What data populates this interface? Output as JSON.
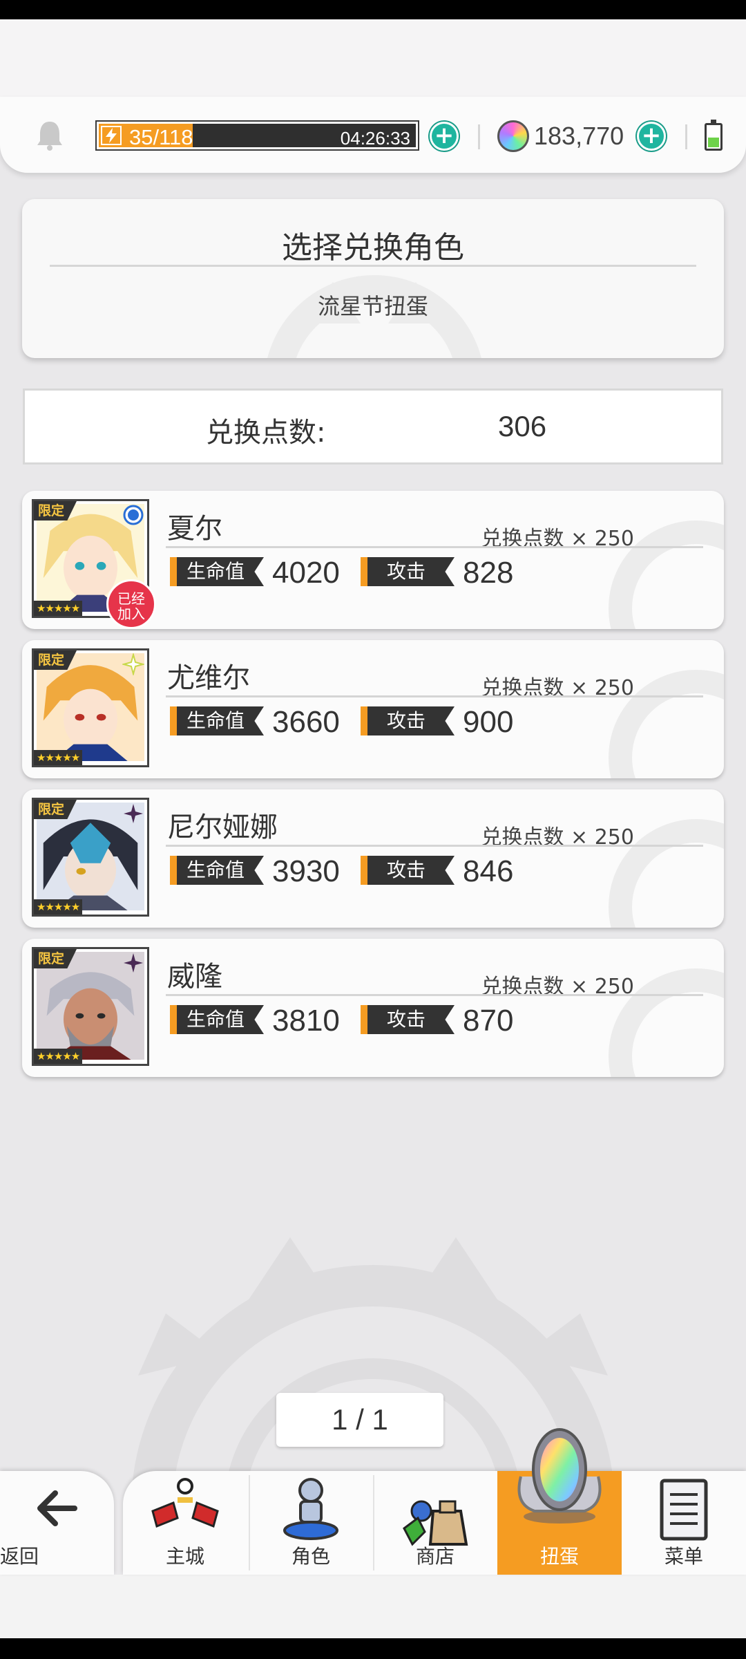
{
  "resource_bar": {
    "stamina_text": "35/118",
    "stamina_fraction": 0.297,
    "stamina_timer": "04:26:33",
    "gems": "183,770"
  },
  "header": {
    "title": "选择兑换角色",
    "subtitle": "流星节扭蛋"
  },
  "points": {
    "label": "兑换点数:",
    "value": "306"
  },
  "characters": [
    {
      "name": "夏尔",
      "cost": "兑换点数 × 250",
      "hp_label": "生命值",
      "hp": "4020",
      "atk_label": "攻击",
      "atk": "828",
      "tag": "限定",
      "joined": "已经加入",
      "stars": "★★★★★"
    },
    {
      "name": "尤维尔",
      "cost": "兑换点数 × 250",
      "hp_label": "生命值",
      "hp": "3660",
      "atk_label": "攻击",
      "atk": "900",
      "tag": "限定",
      "stars": "★★★★★"
    },
    {
      "name": "尼尔娅娜",
      "cost": "兑换点数 × 250",
      "hp_label": "生命值",
      "hp": "3930",
      "atk_label": "攻击",
      "atk": "846",
      "tag": "限定",
      "stars": "★★★★★"
    },
    {
      "name": "威隆",
      "cost": "兑换点数 × 250",
      "hp_label": "生命值",
      "hp": "3810",
      "atk_label": "攻击",
      "atk": "870",
      "tag": "限定",
      "stars": "★★★★★"
    }
  ],
  "pager": "1 / 1",
  "nav": {
    "back": "返回",
    "items": [
      "主城",
      "角色",
      "商店",
      "扭蛋",
      "菜单"
    ],
    "active": "扭蛋"
  },
  "colors": {
    "accent": "#f59c22",
    "plus": "#1fb59f",
    "badge": "#e6344a"
  }
}
